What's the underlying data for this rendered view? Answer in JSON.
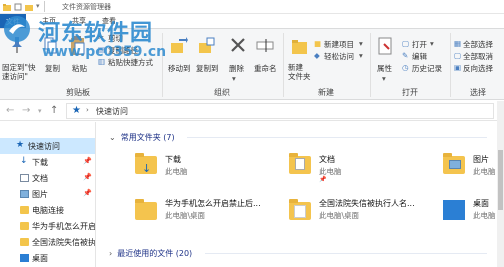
{
  "window": {
    "title": "文件资源管理器"
  },
  "tabs": [
    {
      "label": "文件"
    },
    {
      "label": "主页"
    },
    {
      "label": "共享"
    },
    {
      "label": "查看"
    }
  ],
  "ribbon": {
    "clipboard": {
      "pin_label": "固定到\"快速访问\"",
      "copy": "复制",
      "paste": "粘贴",
      "cut": "剪切",
      "copy_path": "复制路径",
      "paste_shortcut": "粘贴快捷方式",
      "group": "剪贴板"
    },
    "organize": {
      "move_to": "移动到",
      "copy_to": "复制到",
      "delete": "删除",
      "rename": "重命名",
      "group": "组织"
    },
    "new": {
      "new_folder": "新建\n文件夹",
      "new_item": "新建项目",
      "easy_access": "轻松访问",
      "group": "新建"
    },
    "open": {
      "properties": "属性",
      "open": "打开",
      "edit": "编辑",
      "history": "历史记录",
      "group": "打开"
    },
    "select": {
      "select_all": "全部选择",
      "select_none": "全部取消",
      "invert": "反向选择",
      "group": "选择"
    }
  },
  "address": {
    "path": "快速访问"
  },
  "nav": {
    "items": [
      {
        "label": "快速访问",
        "pinned": false
      },
      {
        "label": "下载",
        "pinned": true
      },
      {
        "label": "文档",
        "pinned": true
      },
      {
        "label": "图片",
        "pinned": true
      },
      {
        "label": "电脑连接",
        "pinned": false
      },
      {
        "label": "华为手机怎么开启",
        "pinned": false
      },
      {
        "label": "全国法院失信被执",
        "pinned": false
      },
      {
        "label": "桌面",
        "pinned": false
      }
    ]
  },
  "content": {
    "frequent_header": "常用文件夹 (7)",
    "recent_header": "最近使用的文件 (20)",
    "folders": [
      {
        "name": "下载",
        "location": "此电脑"
      },
      {
        "name": "文档",
        "location": "此电脑"
      },
      {
        "name": "图片",
        "location": "此电脑"
      },
      {
        "name": "华为手机怎么开启禁止后...",
        "location": "此电脑\\桌面"
      },
      {
        "name": "全国法院失信被执行人名...",
        "location": "此电脑\\桌面"
      },
      {
        "name": "桌面",
        "location": "此电脑"
      }
    ]
  },
  "watermark": {
    "line1": "河东软件园",
    "line2": "www.pc0359.cn"
  },
  "colors": {
    "accent": "#1a65b5",
    "folder": "#f3c54c",
    "selected": "#cce8ff",
    "header_text": "#1e3287"
  }
}
